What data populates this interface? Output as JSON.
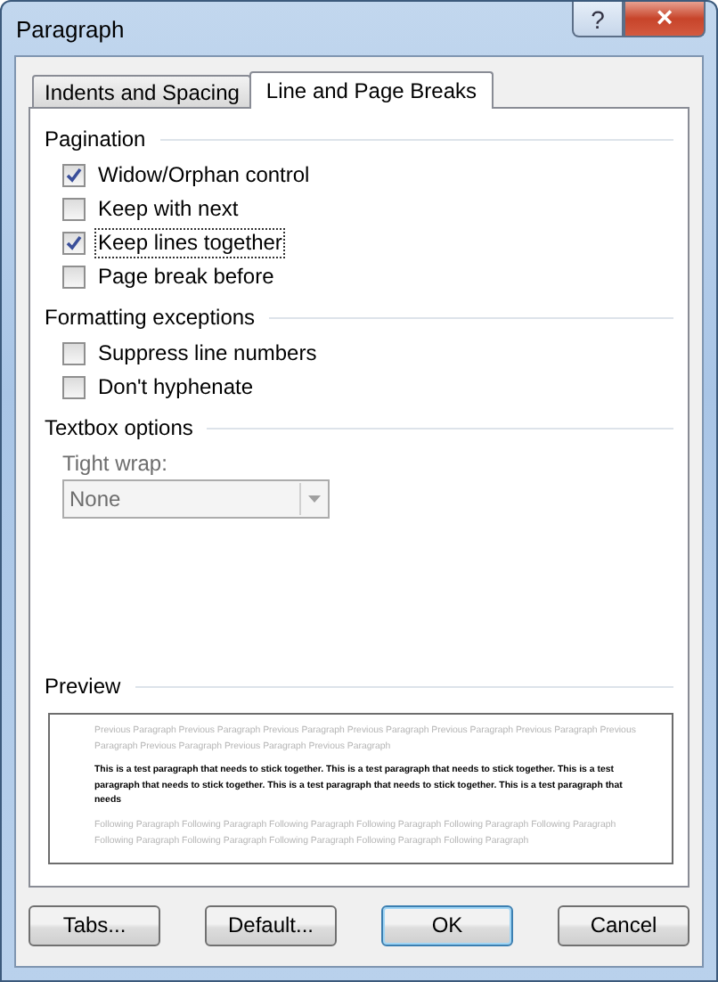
{
  "window": {
    "title": "Paragraph",
    "help_button": "?",
    "close_button": "×"
  },
  "tabs": [
    {
      "label": "Indents and Spacing",
      "selected": false
    },
    {
      "label": "Line and Page Breaks",
      "selected": true
    }
  ],
  "sections": [
    {
      "title": "Pagination",
      "kind": "checks",
      "items": [
        {
          "label": "Widow/Orphan control",
          "checked": true,
          "focused": false
        },
        {
          "label": "Keep with next",
          "checked": false,
          "focused": false
        },
        {
          "label": "Keep lines together",
          "checked": true,
          "focused": true
        },
        {
          "label": "Page break before",
          "checked": false,
          "focused": false
        }
      ]
    },
    {
      "title": "Formatting exceptions",
      "kind": "checks",
      "items": [
        {
          "label": "Suppress line numbers",
          "checked": false,
          "focused": false
        },
        {
          "label": "Don't hyphenate",
          "checked": false,
          "focused": false
        }
      ]
    },
    {
      "title": "Textbox options",
      "kind": "combo",
      "label": "Tight wrap:",
      "value": "None",
      "disabled": true
    }
  ],
  "preview": {
    "title": "Preview",
    "previous": "Previous Paragraph Previous Paragraph Previous Paragraph Previous Paragraph Previous Paragraph Previous Paragraph Previous Paragraph Previous Paragraph Previous Paragraph Previous Paragraph",
    "sample": "This is a test paragraph that needs to stick together.  This is a test paragraph that needs to stick together.  This is a test paragraph that needs to stick together.  This is a test paragraph that needs to stick together.  This is a test paragraph that needs",
    "following": "Following Paragraph Following Paragraph Following Paragraph Following Paragraph Following Paragraph Following Paragraph Following Paragraph Following Paragraph Following Paragraph Following Paragraph Following Paragraph"
  },
  "buttons": [
    {
      "label": "Tabs...",
      "default": false
    },
    {
      "label": "Default...",
      "default": false
    },
    {
      "label": "OK",
      "default": true
    },
    {
      "label": "Cancel",
      "default": false
    }
  ]
}
